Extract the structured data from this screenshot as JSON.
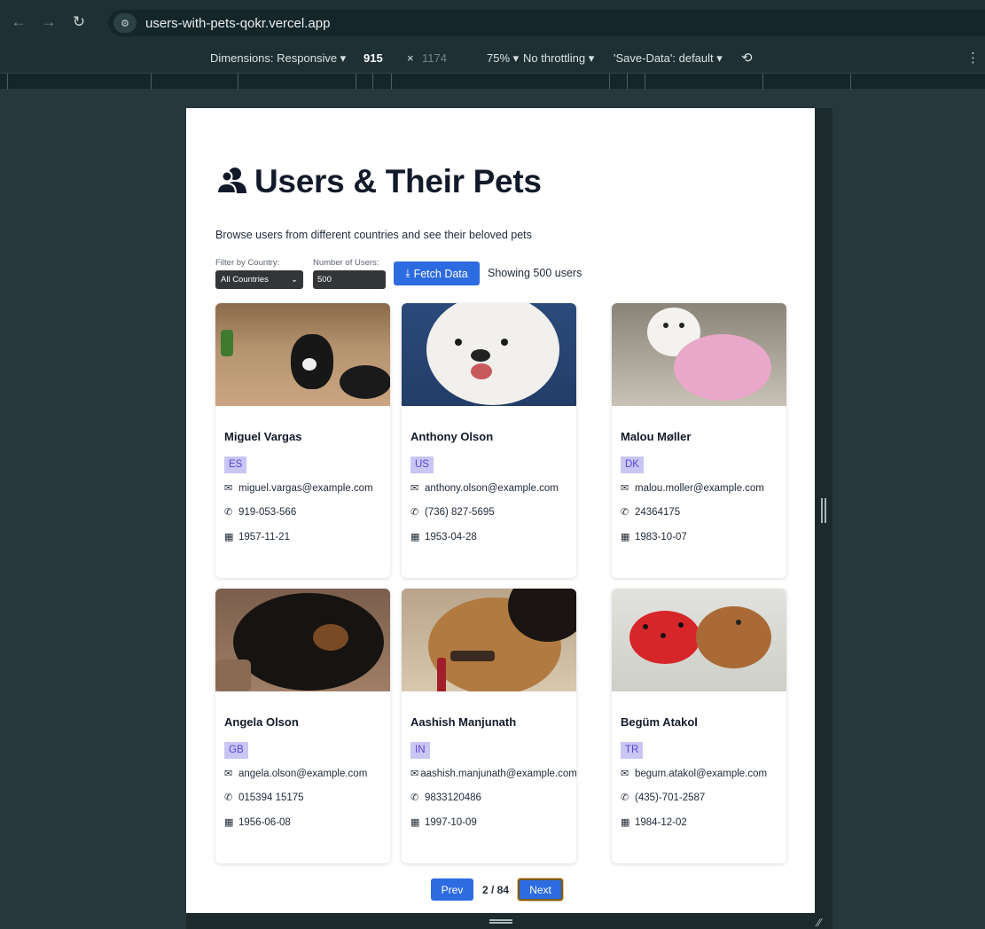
{
  "browser": {
    "url": "users-with-pets-qokr.vercel.app",
    "back_icon": "arrow-left-icon",
    "forward_icon": "arrow-right-icon",
    "reload_icon": "reload-icon"
  },
  "devtools": {
    "dimensions_label": "Dimensions: Responsive ▾",
    "width": "915",
    "times": "×",
    "height": "1174",
    "zoom": "75% ▾",
    "throttling": "No throttling ▾",
    "save_data": "'Save-Data': default ▾"
  },
  "page": {
    "title": "Users & Their Pets",
    "subtitle": "Browse users from different countries and see their beloved pets",
    "filter_label": "Filter by Country:",
    "filter_value": "All Countries",
    "count_label": "Number of Users:",
    "count_value": "500",
    "fetch_label": "Fetch Data",
    "showing": "Showing 500 users"
  },
  "users": [
    {
      "name": "Miguel Vargas",
      "country": "ES",
      "email": "miguel.vargas@example.com",
      "phone": "919-053-566",
      "dob": "1957-11-21"
    },
    {
      "name": "Anthony Olson",
      "country": "US",
      "email": "anthony.olson@example.com",
      "phone": "(736) 827-5695",
      "dob": "1953-04-28"
    },
    {
      "name": "Malou Møller",
      "country": "DK",
      "email": "malou.moller@example.com",
      "phone": "24364175",
      "dob": "1983-10-07"
    },
    {
      "name": "Angela Olson",
      "country": "GB",
      "email": "angela.olson@example.com",
      "phone": "015394 15175",
      "dob": "1956-06-08"
    },
    {
      "name": "Aashish Manjunath",
      "country": "IN",
      "email": "aashish.manjunath@example.com",
      "phone": "9833120486",
      "dob": "1997-10-09"
    },
    {
      "name": "Begüm Atakol",
      "country": "TR",
      "email": "begum.atakol@example.com",
      "phone": "(435)-701-2587",
      "dob": "1984-12-02"
    }
  ],
  "pagination": {
    "prev_label": "Prev",
    "indicator": "2 / 84",
    "next_label": "Next"
  },
  "colors": {
    "accent": "#2d6be0",
    "badge_bg": "#c9c6f4",
    "badge_text": "#5b3fd4"
  }
}
